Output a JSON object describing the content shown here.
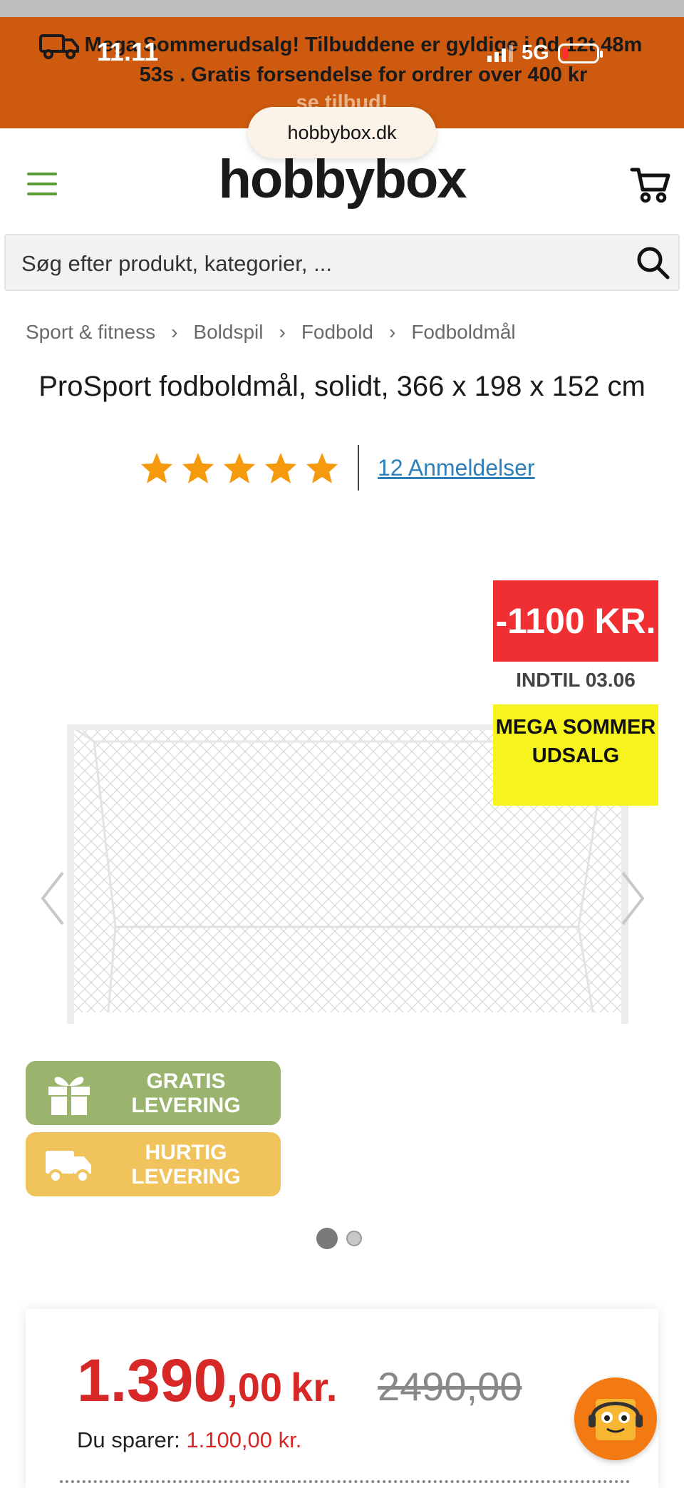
{
  "status": {
    "time": "11.11",
    "network": "5G"
  },
  "banner": {
    "message": "Mega Sommerudsalg! Tilbuddene er gyldige i 0d 12t 48m 53s . Gratis forsendelse for ordrer over 400 kr",
    "link": "se tilbud!"
  },
  "browser": {
    "url": "hobbybox.dk"
  },
  "header": {
    "logo": "hobbybox"
  },
  "search": {
    "placeholder": "Søg efter produkt, kategorier, ..."
  },
  "breadcrumb": [
    "Sport & fitness",
    "Boldspil",
    "Fodbold",
    "Fodboldmål"
  ],
  "product": {
    "title": "ProSport fodboldmål, solidt, 366 x 198 x 152 cm",
    "rating_stars": 5,
    "reviews": "12 Anmeldelser"
  },
  "gallery": {
    "discount": "-1100 KR.",
    "until": "INDTIL 03.06",
    "campaign": "MEGA SOMMER UDSALG",
    "features": [
      {
        "label": "GRATIS LEVERING",
        "icon": "gift-icon",
        "color": "#9ab46e"
      },
      {
        "label": "HURTIG LEVERING",
        "icon": "truck-icon",
        "color": "#f0c35c"
      }
    ],
    "slides": 2,
    "active_slide": 1
  },
  "price": {
    "main": "1.390",
    "decimals": ",00",
    "currency": "kr.",
    "old": "2490,00",
    "save_label": "Du sparer:",
    "save_amount": "1.100,00 kr."
  },
  "colors": {
    "banner": "#cd5a0f",
    "accent_green": "#5c9a3a",
    "price_red": "#d72727",
    "discount_red": "#ef2f32",
    "mega_yellow": "#f6f31e"
  }
}
